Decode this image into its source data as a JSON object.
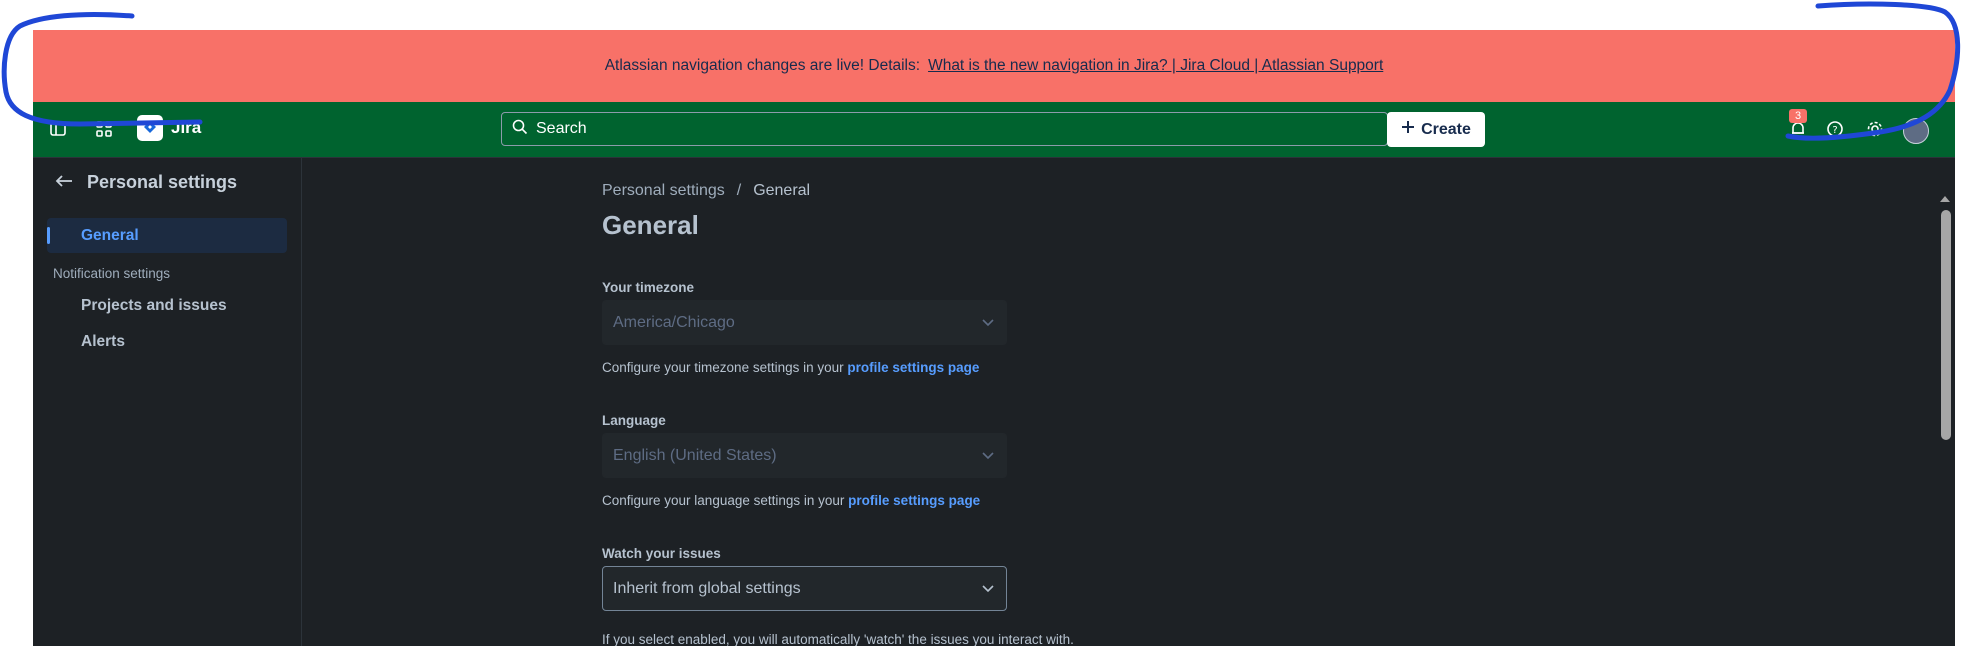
{
  "banner": {
    "text": "Atlassian navigation changes are live! Details:",
    "link": "What is the new navigation in Jira? | Jira Cloud | Atlassian Support"
  },
  "topnav": {
    "app_name": "Jira",
    "search_placeholder": "Search",
    "create_label": "Create",
    "notifications_count": "3",
    "icons": [
      "sidebar-toggle-icon",
      "app-switcher-icon",
      "jira-logo-icon",
      "search-icon",
      "plus-icon",
      "bell-icon",
      "help-icon",
      "gear-icon"
    ]
  },
  "sidebar": {
    "title": "Personal settings",
    "items": [
      {
        "label": "General",
        "active": true
      },
      {
        "label": "Projects and issues",
        "active": false
      },
      {
        "label": "Alerts",
        "active": false
      }
    ],
    "section_label": "Notification settings"
  },
  "main": {
    "breadcrumb": [
      "Personal settings",
      "/",
      "General"
    ],
    "title": "General",
    "timezone": {
      "label": "Your timezone",
      "value": "America/Chicago",
      "help_text": "Configure your timezone settings in your",
      "help_link": "profile settings page"
    },
    "language": {
      "label": "Language",
      "value": "English (United States)",
      "help_text": "Configure your language settings in your",
      "help_link": "profile settings page"
    },
    "watch": {
      "label": "Watch your issues",
      "value": "Inherit from global settings",
      "help_text": "If you select enabled, you will automatically 'watch' the issues you interact with."
    }
  },
  "colors": {
    "banner": "#f87168",
    "topnav": "#00632f",
    "background": "#1d2125",
    "link": "#579dff",
    "annotation": "#1f47d6"
  }
}
